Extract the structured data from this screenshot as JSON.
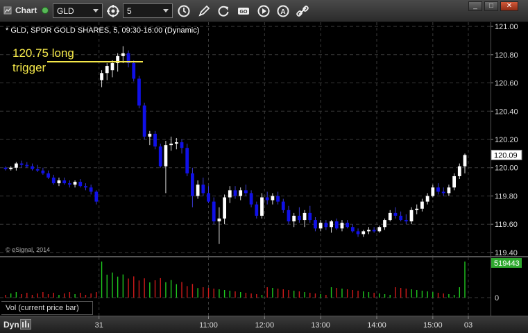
{
  "toolbar": {
    "title": "Chart",
    "symbol": "GLD",
    "interval": "5",
    "window_buttons": [
      "_",
      "□",
      "✕"
    ],
    "tool_icons": [
      "cycle-icon",
      "refresh-clock-icon",
      "pencil-icon",
      "rotate-icon",
      "study-icon",
      "play-icon",
      "font-a-icon",
      "link-icon"
    ]
  },
  "chart": {
    "header": "* GLD, SPDR GOLD SHARES, 5, 09:30-16:00 (Dynamic)",
    "watermark": "© eSignal, 2014",
    "annotation_line1": "120.75 long",
    "annotation_line2": "trigger",
    "annotation_price": 120.75,
    "last_price_label": "120.09",
    "vol_last_label": "519443",
    "vol_legend": "Vol (current price bar)",
    "dyn_label": "Dyn",
    "colors": {
      "up_candle": "#ffffff",
      "down_candle": "#1010e8",
      "annotation": "#f5e84a",
      "vol_up": "#1fc91f",
      "vol_down": "#d01a1a",
      "last_price_tag": "#2ea82e"
    }
  },
  "chart_data": {
    "type": "candlestick",
    "price_axis": {
      "ticks": [
        "121.00",
        "120.80",
        "120.60",
        "120.40",
        "120.20",
        "120.00",
        "119.80",
        "119.60",
        "119.40"
      ],
      "ylim": [
        119.38,
        121.02
      ]
    },
    "volume_axis": {
      "ticks": [
        "0"
      ]
    },
    "time_axis": {
      "labels": [
        "31",
        "11:00",
        "12:00",
        "13:00",
        "14:00",
        "15:00",
        "03"
      ]
    },
    "candles": [
      [
        120.0,
        120.01,
        119.98,
        119.99
      ],
      [
        119.99,
        120.01,
        119.98,
        120.0
      ],
      [
        120.0,
        120.04,
        119.98,
        120.03
      ],
      [
        120.03,
        120.05,
        120.0,
        120.02
      ],
      [
        120.02,
        120.04,
        120.0,
        120.01
      ],
      [
        120.01,
        120.03,
        119.98,
        119.99
      ],
      [
        119.99,
        120.02,
        119.97,
        119.98
      ],
      [
        119.98,
        120.0,
        119.95,
        119.96
      ],
      [
        119.96,
        119.98,
        119.92,
        119.93
      ],
      [
        119.93,
        119.95,
        119.88,
        119.89
      ],
      [
        119.89,
        119.93,
        119.87,
        119.91
      ],
      [
        119.91,
        119.93,
        119.88,
        119.89
      ],
      [
        119.89,
        119.91,
        119.86,
        119.88
      ],
      [
        119.88,
        119.91,
        119.86,
        119.9
      ],
      [
        119.9,
        119.92,
        119.86,
        119.87
      ],
      [
        119.87,
        119.89,
        119.84,
        119.86
      ],
      [
        119.86,
        119.88,
        119.81,
        119.83
      ],
      [
        119.83,
        119.84,
        119.74,
        119.76
      ],
      [
        120.62,
        120.69,
        120.57,
        120.67
      ],
      [
        120.67,
        120.74,
        120.62,
        120.72
      ],
      [
        120.69,
        120.76,
        120.64,
        120.74
      ],
      [
        120.74,
        120.81,
        120.68,
        120.79
      ],
      [
        120.79,
        120.86,
        120.74,
        120.81
      ],
      [
        120.81,
        120.83,
        120.71,
        120.74
      ],
      [
        120.74,
        120.76,
        120.61,
        120.63
      ],
      [
        120.63,
        120.65,
        120.42,
        120.44
      ],
      [
        120.44,
        120.46,
        120.2,
        120.22
      ],
      [
        120.22,
        120.26,
        120.16,
        120.24
      ],
      [
        120.24,
        120.26,
        120.13,
        120.15
      ],
      [
        120.15,
        120.17,
        120.0,
        120.01
      ],
      [
        120.01,
        120.19,
        119.82,
        120.16
      ],
      [
        120.16,
        120.22,
        120.12,
        120.17
      ],
      [
        120.17,
        120.21,
        120.13,
        120.18
      ],
      [
        120.18,
        120.2,
        120.1,
        120.14
      ],
      [
        120.14,
        120.17,
        119.94,
        119.96
      ],
      [
        119.96,
        120.0,
        119.72,
        119.8
      ],
      [
        119.8,
        119.91,
        119.78,
        119.88
      ],
      [
        119.88,
        119.93,
        119.8,
        119.82
      ],
      [
        119.82,
        119.87,
        119.75,
        119.76
      ],
      [
        119.76,
        119.79,
        119.6,
        119.62
      ],
      [
        119.62,
        119.72,
        119.46,
        119.64
      ],
      [
        119.64,
        119.81,
        119.6,
        119.79
      ],
      [
        119.79,
        119.87,
        119.75,
        119.84
      ],
      [
        119.84,
        119.87,
        119.78,
        119.8
      ],
      [
        119.8,
        119.86,
        119.77,
        119.84
      ],
      [
        119.84,
        119.88,
        119.8,
        119.82
      ],
      [
        119.82,
        119.84,
        119.72,
        119.74
      ],
      [
        119.74,
        119.76,
        119.64,
        119.66
      ],
      [
        119.66,
        119.82,
        119.64,
        119.79
      ],
      [
        119.79,
        119.83,
        119.74,
        119.77
      ],
      [
        119.77,
        119.82,
        119.74,
        119.8
      ],
      [
        119.8,
        119.83,
        119.74,
        119.76
      ],
      [
        119.76,
        119.78,
        119.68,
        119.7
      ],
      [
        119.7,
        119.73,
        119.6,
        119.62
      ],
      [
        119.62,
        119.68,
        119.58,
        119.66
      ],
      [
        119.66,
        119.72,
        119.61,
        119.63
      ],
      [
        119.63,
        119.7,
        119.58,
        119.68
      ],
      [
        119.68,
        119.73,
        119.61,
        119.63
      ],
      [
        119.63,
        119.65,
        119.55,
        119.57
      ],
      [
        119.57,
        119.63,
        119.55,
        119.61
      ],
      [
        119.61,
        119.63,
        119.56,
        119.58
      ],
      [
        119.58,
        119.63,
        119.54,
        119.62
      ],
      [
        119.62,
        119.64,
        119.56,
        119.57
      ],
      [
        119.57,
        119.63,
        119.55,
        119.61
      ],
      [
        119.61,
        119.63,
        119.57,
        119.58
      ],
      [
        119.58,
        119.6,
        119.54,
        119.55
      ],
      [
        119.55,
        119.57,
        119.51,
        119.53
      ],
      [
        119.53,
        119.56,
        119.51,
        119.55
      ],
      [
        119.55,
        119.58,
        119.53,
        119.56
      ],
      [
        119.56,
        119.58,
        119.54,
        119.55
      ],
      [
        119.55,
        119.59,
        119.54,
        119.58
      ],
      [
        119.58,
        119.64,
        119.56,
        119.63
      ],
      [
        119.63,
        119.7,
        119.62,
        119.68
      ],
      [
        119.68,
        119.72,
        119.64,
        119.66
      ],
      [
        119.66,
        119.69,
        119.62,
        119.63
      ],
      [
        119.63,
        119.67,
        119.6,
        119.62
      ],
      [
        119.62,
        119.72,
        119.6,
        119.7
      ],
      [
        119.7,
        119.74,
        119.67,
        119.71
      ],
      [
        119.71,
        119.78,
        119.69,
        119.76
      ],
      [
        119.76,
        119.82,
        119.74,
        119.8
      ],
      [
        119.8,
        119.88,
        119.79,
        119.86
      ],
      [
        119.86,
        119.89,
        119.81,
        119.83
      ],
      [
        119.83,
        119.86,
        119.8,
        119.82
      ],
      [
        119.82,
        119.88,
        119.8,
        119.86
      ],
      [
        119.86,
        119.96,
        119.84,
        119.94
      ],
      [
        119.94,
        120.03,
        119.92,
        120.01
      ],
      [
        120.01,
        120.1,
        119.96,
        120.09
      ]
    ],
    "volume_session_start_index": 18
  }
}
